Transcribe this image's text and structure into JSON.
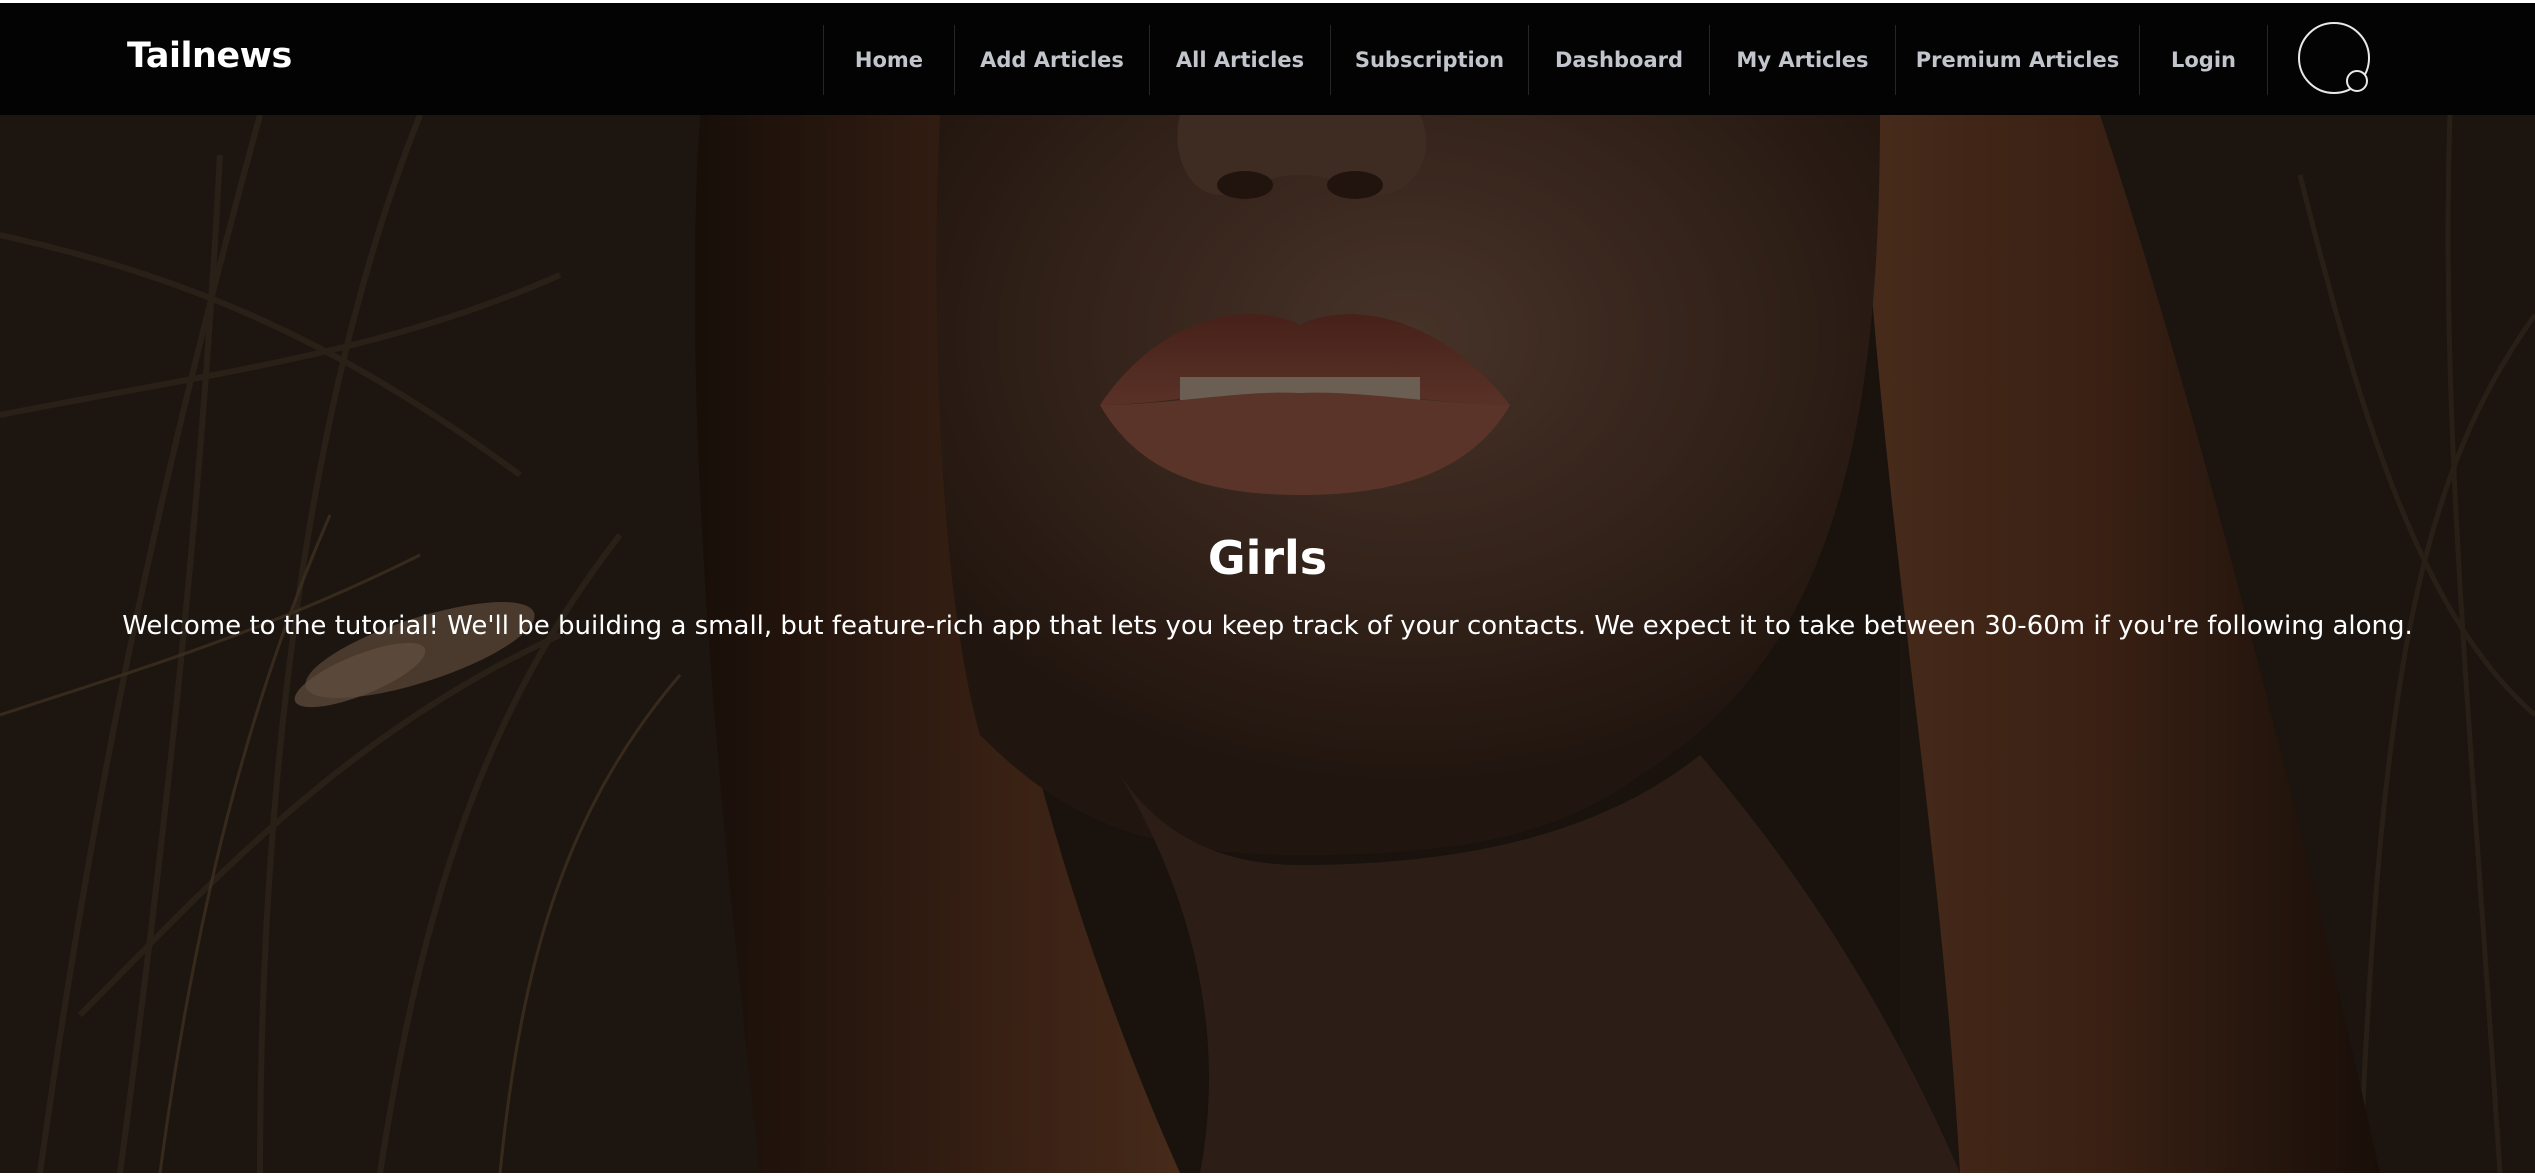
{
  "brand": {
    "name": "Tailnews"
  },
  "nav": {
    "items": [
      {
        "label": "Home"
      },
      {
        "label": "Add Articles"
      },
      {
        "label": "All Articles"
      },
      {
        "label": "Subscription"
      },
      {
        "label": "Dashboard"
      },
      {
        "label": "My Articles"
      },
      {
        "label": "Premium Articles"
      },
      {
        "label": "Login"
      }
    ]
  },
  "hero": {
    "title": "Girls",
    "text": "Welcome to the tutorial! We'll be building a small, but feature-rich app that lets you keep track of your contacts. We expect it to take between 30-60m if you're following along.",
    "image": "portrait photo of a woman's lower face with long auburn hair, dried grass in background, darkened overlay"
  },
  "colors": {
    "navbar_bg": "#030303",
    "nav_text": "#c2c5cc",
    "brand_text": "#ffffff",
    "hero_text": "#ffffff"
  },
  "icons": {
    "avatar": "user-avatar-circle-icon"
  }
}
